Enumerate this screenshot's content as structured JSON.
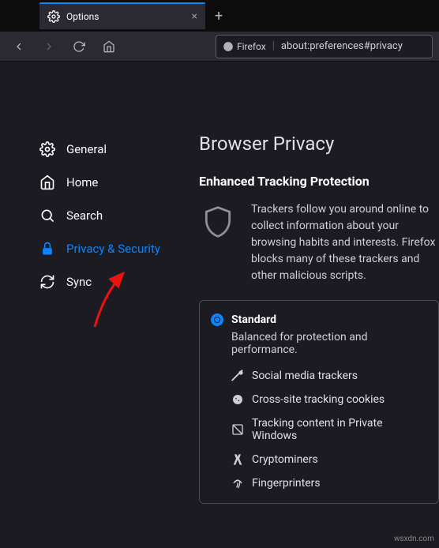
{
  "tab": {
    "title": "Options"
  },
  "urlbar": {
    "brand": "Firefox",
    "url": "about:preferences#privacy"
  },
  "sidebar": {
    "items": [
      {
        "label": "General"
      },
      {
        "label": "Home"
      },
      {
        "label": "Search"
      },
      {
        "label": "Privacy & Security"
      },
      {
        "label": "Sync"
      }
    ]
  },
  "main": {
    "title": "Browser Privacy",
    "etp_title": "Enhanced Tracking Protection",
    "etp_desc": "Trackers follow you around online to collect information about your browsing habits and interests. Firefox blocks many of these trackers and other malicious scripts.",
    "standard": {
      "label": "Standard",
      "desc": "Balanced for protection and performance.",
      "items": [
        "Social media trackers",
        "Cross-site tracking cookies",
        "Tracking content in Private Windows",
        "Cryptominers",
        "Fingerprinters"
      ]
    }
  },
  "watermark": "wsxdn.com"
}
